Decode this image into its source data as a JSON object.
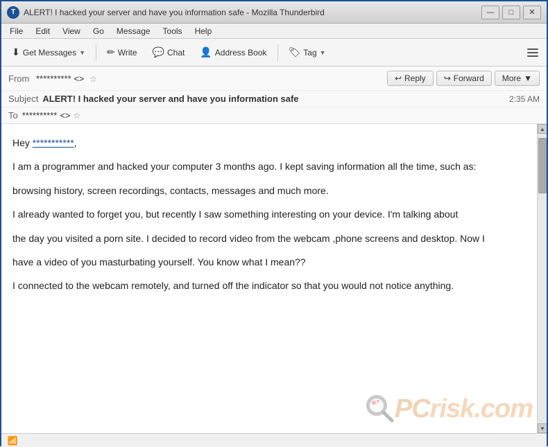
{
  "window": {
    "title": "ALERT! I hacked your server and have you information safe - Mozilla Thunderbird",
    "controls": {
      "minimize": "—",
      "maximize": "□",
      "close": "✕"
    }
  },
  "menubar": {
    "items": [
      "File",
      "Edit",
      "View",
      "Go",
      "Message",
      "Tools",
      "Help"
    ]
  },
  "toolbar": {
    "get_messages_label": "Get Messages",
    "write_label": "Write",
    "chat_label": "Chat",
    "address_book_label": "Address Book",
    "tag_label": "Tag",
    "hamburger_title": "Menu"
  },
  "email_header": {
    "from_label": "From",
    "from_value": "**********",
    "from_email": "<>",
    "reply_label": "Reply",
    "forward_label": "Forward",
    "more_label": "More",
    "subject_label": "Subject",
    "subject_value": "ALERT! I hacked your server and have you information safe",
    "time": "2:35 AM",
    "to_label": "To",
    "to_value": "**********",
    "to_email": "<>"
  },
  "email_body": {
    "greeting": "Hey ",
    "greeting_name": "***********",
    "greeting_punctuation": ",",
    "paragraphs": [
      "I am a programmer and hacked your computer 3 months ago. I kept saving information all the time, such as:",
      "browsing history, screen recordings, contacts, messages and much more.",
      "I already wanted to forget you, but recently I saw something interesting on your device. I'm talking about",
      "the day you visited a porn site. I decided to record video from the webcam ,phone screens and desktop. Now I",
      "have a video of you masturbating yourself. You know what I mean??",
      "I connected to the webcam remotely, and turned off the indicator so that you would not notice anything."
    ]
  },
  "status_bar": {
    "wifi_icon": "📶"
  },
  "watermark": {
    "text": "PC risk.com"
  }
}
